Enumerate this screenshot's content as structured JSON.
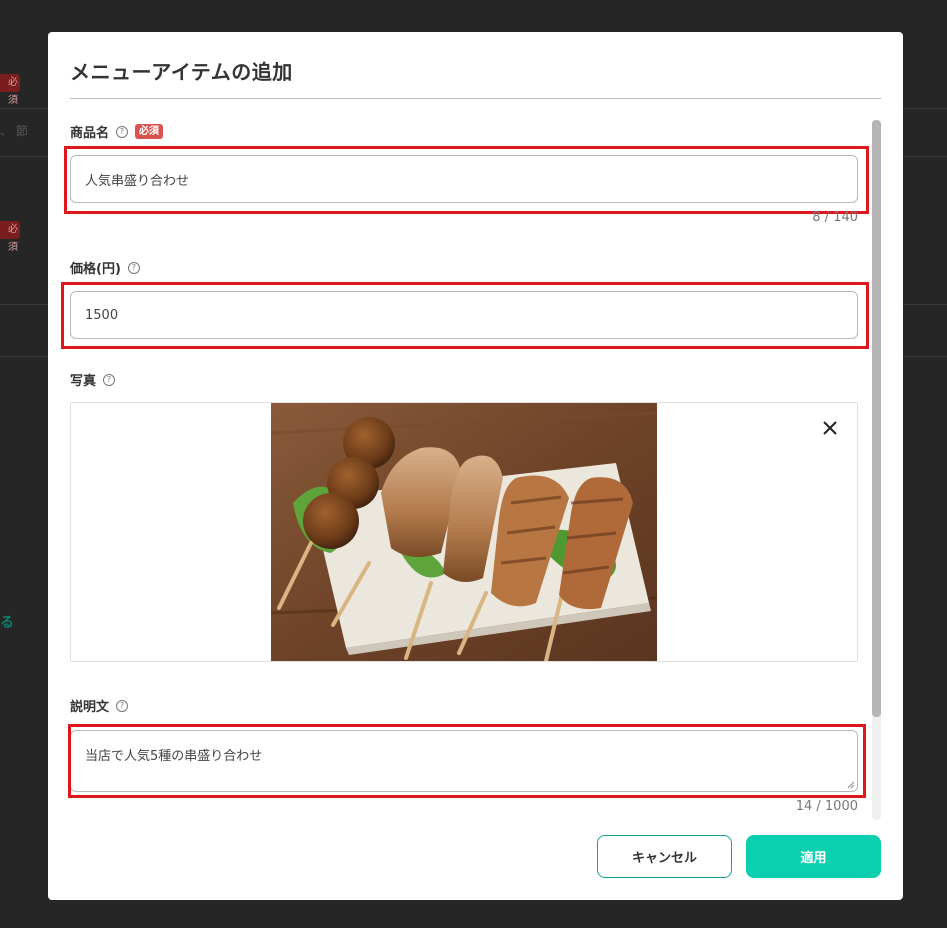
{
  "background": {
    "badge1": "必須",
    "badge2": "必須",
    "fragment_text": "、 節",
    "green_fragment": "る"
  },
  "modal": {
    "title": "メニューアイテムの追加",
    "fields": {
      "name": {
        "label": "商品名",
        "required_badge": "必須",
        "value": "人気串盛り合わせ",
        "counter": "8 / 140"
      },
      "price": {
        "label": "価格(円)",
        "value": "1500"
      },
      "photo": {
        "label": "写真"
      },
      "description": {
        "label": "説明文",
        "value": "当店で人気5種の串盛り合わせ",
        "counter": "14 / 1000"
      }
    },
    "help_glyph": "?",
    "buttons": {
      "cancel": "キャンセル",
      "apply": "適用"
    }
  },
  "colors": {
    "accent": "#0bcfae",
    "highlight": "#e0161f",
    "required": "#d9534f"
  }
}
